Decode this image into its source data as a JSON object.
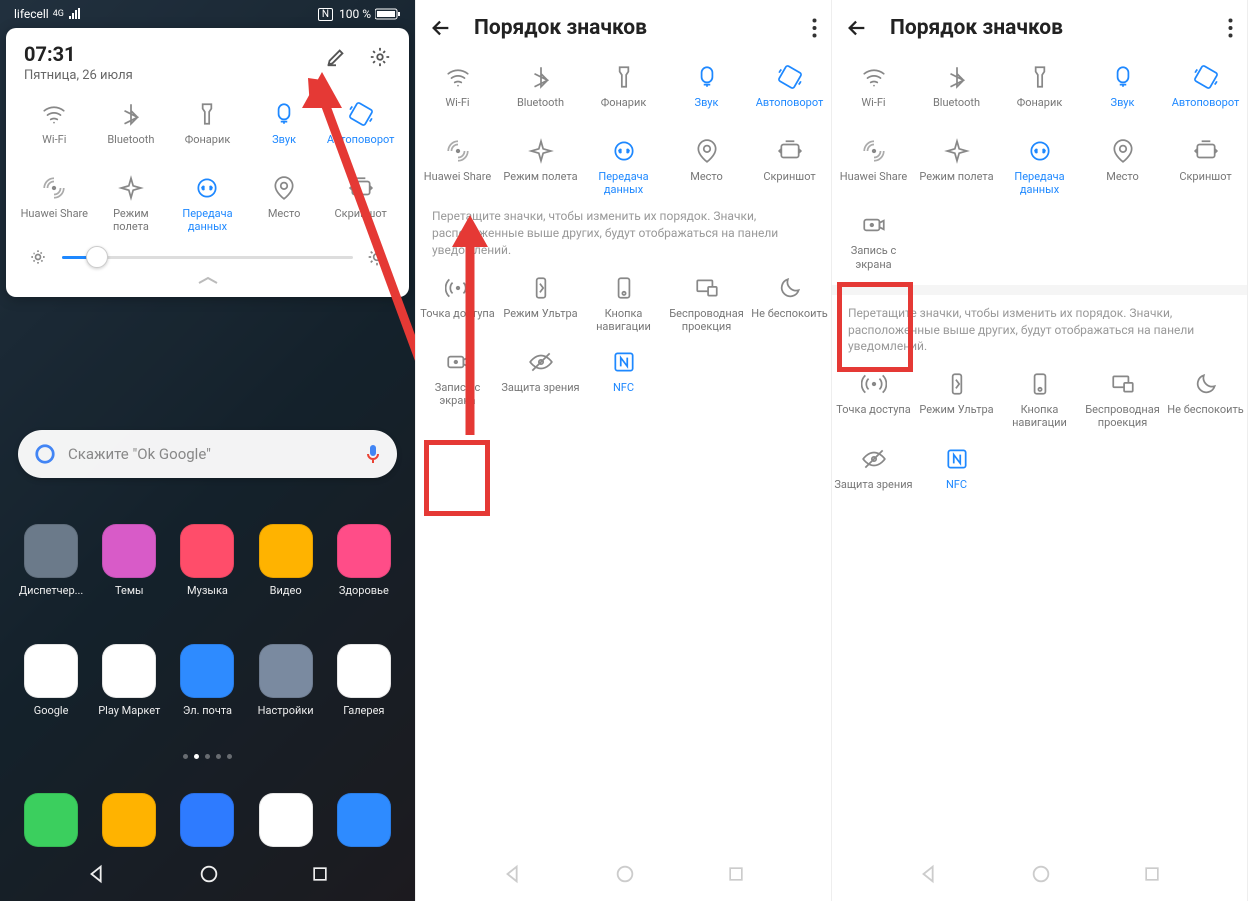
{
  "status": {
    "carrier": "lifecell",
    "net": "4G",
    "nfc": "N",
    "batt": "100 %"
  },
  "shade": {
    "time": "07:31",
    "date": "Пятница, 26 июля"
  },
  "toggles": [
    {
      "k": "wifi",
      "l": "Wi-Fi",
      "on": false
    },
    {
      "k": "bt",
      "l": "Bluetooth",
      "on": false
    },
    {
      "k": "torch",
      "l": "Фонарик",
      "on": false
    },
    {
      "k": "sound",
      "l": "Звук",
      "on": true
    },
    {
      "k": "rotate",
      "l": "Автоповорот",
      "on": true
    },
    {
      "k": "hshare",
      "l": "Huawei Share",
      "on": false
    },
    {
      "k": "plane",
      "l": "Режим полета",
      "on": false
    },
    {
      "k": "data",
      "l": "Передача данных",
      "on": true
    },
    {
      "k": "loc",
      "l": "Место",
      "on": false
    },
    {
      "k": "shot",
      "l": "Скриншот",
      "on": false
    }
  ],
  "search": {
    "placeholder": "Скажите \"Ok Google\""
  },
  "apps1": [
    {
      "l": "Диспетчер...",
      "c": "#6b7a8a"
    },
    {
      "l": "Темы",
      "c": "#d85bc8"
    },
    {
      "l": "Музыка",
      "c": "#ff4d6a"
    },
    {
      "l": "Видео",
      "c": "#ffb300"
    },
    {
      "l": "Здоровье",
      "c": "#ff4d88"
    }
  ],
  "apps2": [
    {
      "l": "Google",
      "c": "#fff"
    },
    {
      "l": "Play Маркет",
      "c": "#fff"
    },
    {
      "l": "Эл. почта",
      "c": "#2e8bff"
    },
    {
      "l": "Настройки",
      "c": "#7a8aa0"
    },
    {
      "l": "Галерея",
      "c": "#fff"
    }
  ],
  "dock": [
    {
      "c": "#3bcf5e"
    },
    {
      "c": "#ffb300"
    },
    {
      "c": "#2e7bff"
    },
    {
      "c": "#fff"
    },
    {
      "c": "#2e8bff"
    }
  ],
  "order": {
    "title": "Порядок значков",
    "hint": "Перетащите значки, чтобы изменить их порядок. Значки, расположенные выше других, будут отображаться на панели уведомлений.",
    "lower2": [
      {
        "k": "hotspot",
        "l": "Точка доступа"
      },
      {
        "k": "ultra",
        "l": "Режим Ультра"
      },
      {
        "k": "navbtn",
        "l": "Кнопка навигации"
      },
      {
        "k": "cast",
        "l": "Беспроводная проекция"
      },
      {
        "k": "dnd",
        "l": "Не беспокоить"
      },
      {
        "k": "rec",
        "l": "Запись с экрана"
      },
      {
        "k": "eye",
        "l": "Защита зрения"
      },
      {
        "k": "nfc",
        "l": "NFC",
        "on": true
      }
    ],
    "upper3_extra": {
      "k": "rec",
      "l": "Запись с экрана"
    },
    "lower3": [
      {
        "k": "hotspot",
        "l": "Точка доступа"
      },
      {
        "k": "ultra",
        "l": "Режим Ультра"
      },
      {
        "k": "navbtn",
        "l": "Кнопка навигации"
      },
      {
        "k": "cast",
        "l": "Беспроводная проекция"
      },
      {
        "k": "dnd",
        "l": "Не беспокоить"
      },
      {
        "k": "eye",
        "l": "Защита зрения"
      },
      {
        "k": "nfc",
        "l": "NFC",
        "on": true
      }
    ]
  }
}
